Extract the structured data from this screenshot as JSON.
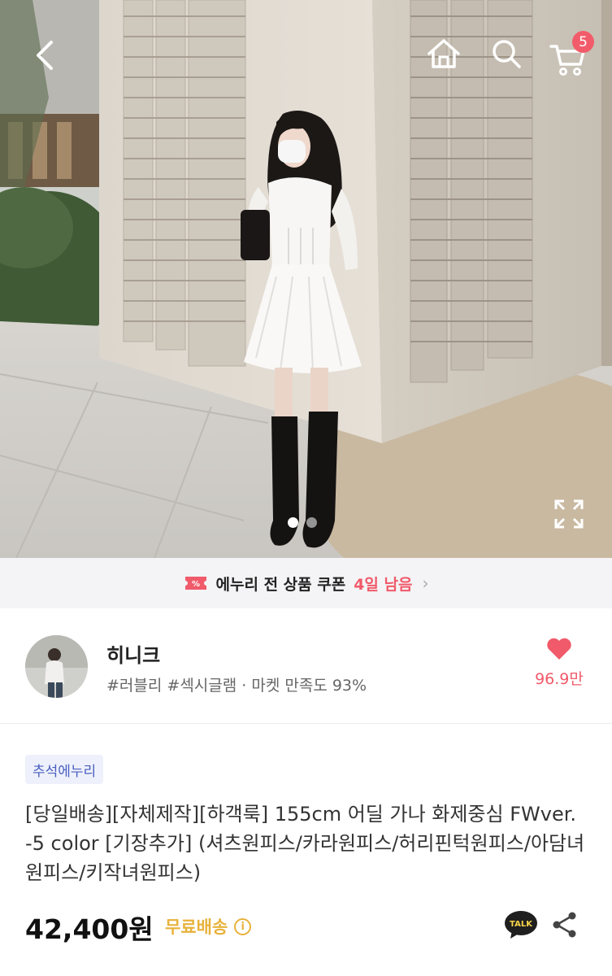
{
  "header": {
    "back_icon": "chevron-left-icon",
    "home_icon": "home-icon",
    "search_icon": "search-icon",
    "cart_icon": "cart-icon",
    "cart_count": "5"
  },
  "gallery": {
    "current_index": 1,
    "total": 2,
    "expand_icon": "expand-icon"
  },
  "coupon_banner": {
    "text": "에누리 전 상품 쿠폰",
    "remaining": "4일 남음",
    "chevron": "›"
  },
  "shop": {
    "name": "히니크",
    "tags": "#러블리 #섹시글램 · 마켓 만족도 93%",
    "likes": "96.9만"
  },
  "product": {
    "badge": "추석에누리",
    "title": "[당일배송][자체제작][하객룩] 155cm 어딜 가나 화제중심 FWver. -5 color [기장추가] (셔츠원피스/카라원피스/허리핀턱원피스/아담녀원피스/키작녀원피스)",
    "price": "42,400원",
    "shipping": "무료배송",
    "info_icon": "i",
    "talk_label": "TALK"
  },
  "colors": {
    "accent": "#f05a6a",
    "shipping": "#e8b23a",
    "badge_text": "#4a5fc1",
    "badge_bg": "#eef1fb"
  }
}
